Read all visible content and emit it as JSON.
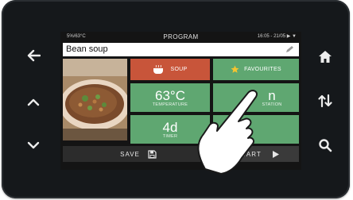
{
  "status": {
    "left": "5%/63°C",
    "title": "PROGRAM",
    "right": "16:05 - 21/05 ▶ ▼"
  },
  "recipe": {
    "name": "Bean soup",
    "edit_icon": "pencil-icon"
  },
  "tiles": {
    "soup": {
      "label": "SOUP",
      "icon": "pot-icon"
    },
    "favorites": {
      "label": "FAVOURITES",
      "icon": "star-icon"
    },
    "temperature": {
      "value": "63°C",
      "label": "TEMPERATURE"
    },
    "core": {
      "value": "n",
      "label": "STATION"
    },
    "timer": {
      "value": "4d",
      "label": "TIMER"
    },
    "fourth": {
      "value": "",
      "label": ""
    }
  },
  "bottom": {
    "save_label": "SAVE",
    "start_label": "START"
  },
  "hardware": {
    "left": [
      "back-arrow-icon",
      "chevron-up-icon",
      "chevron-down-icon"
    ],
    "right": [
      "home-icon",
      "sort-arrows-icon",
      "search-icon"
    ]
  },
  "colors": {
    "accent_green": "#5fa771",
    "accent_red": "#c8553a",
    "bezel": "#15181b"
  }
}
